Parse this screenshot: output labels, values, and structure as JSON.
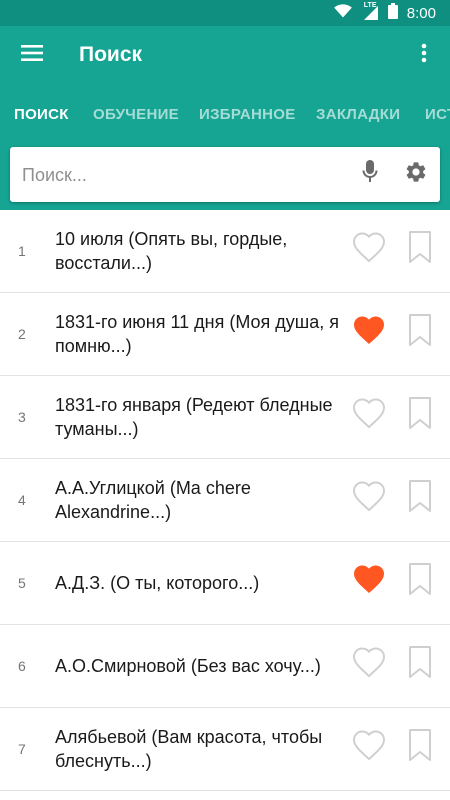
{
  "status_bar": {
    "network_label": "LTE",
    "time": "8:00",
    "icons": [
      "wifi-icon",
      "cellular-signal-icon",
      "battery-icon"
    ]
  },
  "app_bar": {
    "title": "Поиск",
    "icons": [
      "menu-icon",
      "more-vert-icon"
    ]
  },
  "tabs": [
    {
      "label": "ПОИСК",
      "active": true
    },
    {
      "label": "ОБУЧЕНИЕ",
      "active": false
    },
    {
      "label": "ИЗБРАННОЕ",
      "active": false
    },
    {
      "label": "ЗАКЛАДКИ",
      "active": false
    },
    {
      "label": "ИСТ",
      "active": false
    }
  ],
  "search": {
    "placeholder": "Поиск...",
    "value": "",
    "icons": [
      "mic-icon",
      "settings-icon"
    ]
  },
  "list": {
    "items": [
      {
        "number": "1",
        "title": "10 июля (Опять вы, гордые, восстали...)",
        "favorite": false,
        "bookmarked": false
      },
      {
        "number": "2",
        "title": "1831-го июня 11 дня (Моя душа, я помню...)",
        "favorite": true,
        "bookmarked": false
      },
      {
        "number": "3",
        "title": "1831-го января (Редеют бледные туманы...)",
        "favorite": false,
        "bookmarked": false
      },
      {
        "number": "4",
        "title": "А.А.Углицкой (Ma chere Alexandrine...)",
        "favorite": false,
        "bookmarked": false
      },
      {
        "number": "5",
        "title": "А.Д.З. (О ты, которого...)",
        "favorite": true,
        "bookmarked": false
      },
      {
        "number": "6",
        "title": "А.О.Смирновой (Без вас хочу...)",
        "favorite": false,
        "bookmarked": false
      },
      {
        "number": "7",
        "title": "Алябьевой (Вам красота, чтобы блеснуть...)",
        "favorite": false,
        "bookmarked": false
      }
    ]
  },
  "colors": {
    "primary": "#16a493",
    "primary_dark": "#0f8f80",
    "favorite_active": "#ff5722",
    "icon_inactive": "#cfcfcf"
  }
}
